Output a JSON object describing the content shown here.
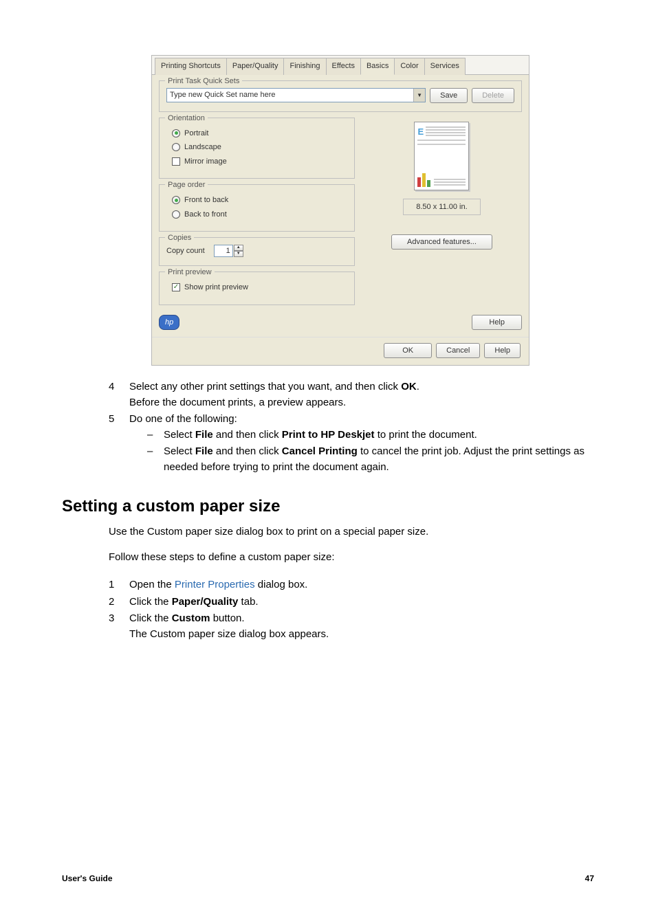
{
  "dialog": {
    "tabs": [
      "Printing Shortcuts",
      "Paper/Quality",
      "Finishing",
      "Effects",
      "Basics",
      "Color",
      "Services"
    ],
    "active_tab_index": 4,
    "quicksets": {
      "legend": "Print Task Quick Sets",
      "placeholder": "Type new Quick Set name here",
      "save": "Save",
      "delete": "Delete"
    },
    "orientation": {
      "legend": "Orientation",
      "portrait": "Portrait",
      "landscape": "Landscape",
      "mirror": "Mirror image",
      "selected": "portrait",
      "mirror_checked": false
    },
    "page_order": {
      "legend": "Page order",
      "front_to_back": "Front to back",
      "back_to_front": "Back to front",
      "selected": "front_to_back"
    },
    "copies": {
      "legend": "Copies",
      "label": "Copy count",
      "value": "1"
    },
    "print_preview": {
      "legend": "Print preview",
      "label": "Show print preview",
      "checked": true
    },
    "paper_dims": "8.50 x 11.00 in.",
    "advanced_features": "Advanced features...",
    "help": "Help",
    "hp_logo_text": "hp",
    "buttons": {
      "ok": "OK",
      "cancel": "Cancel",
      "help": "Help"
    }
  },
  "steps": {
    "s4_num": "4",
    "s4_text_a": "Select any other print settings that you want, and then click ",
    "s4_bold": "OK",
    "s4_text_b": ".",
    "s4_line2": "Before the document prints, a preview appears.",
    "s5_num": "5",
    "s5_text": "Do one of the following:",
    "s5_b1_a": "Select ",
    "s5_b1_bold1": "File",
    "s5_b1_b": " and then click ",
    "s5_b1_bold2": "Print to HP Deskjet",
    "s5_b1_c": " to print the document.",
    "s5_b2_a": "Select ",
    "s5_b2_bold1": "File",
    "s5_b2_b": " and then click ",
    "s5_b2_bold2": "Cancel Printing",
    "s5_b2_c": " to cancel the print job. Adjust the print settings as needed before trying to print the document again."
  },
  "heading": "Setting a custom paper size",
  "body": {
    "p1": "Use the Custom paper size dialog box to print on a special paper size.",
    "p2": "Follow these steps to define a custom paper size:",
    "n1_num": "1",
    "n1_a": "Open the ",
    "n1_link": "Printer Properties",
    "n1_b": " dialog box.",
    "n2_num": "2",
    "n2_a": "Click the ",
    "n2_bold": "Paper/Quality",
    "n2_b": " tab.",
    "n3_num": "3",
    "n3_a": "Click the ",
    "n3_bold": "Custom",
    "n3_b": " button.",
    "n3_line2": "The Custom paper size dialog box appears."
  },
  "footer": {
    "left": "User's Guide",
    "right": "47"
  }
}
